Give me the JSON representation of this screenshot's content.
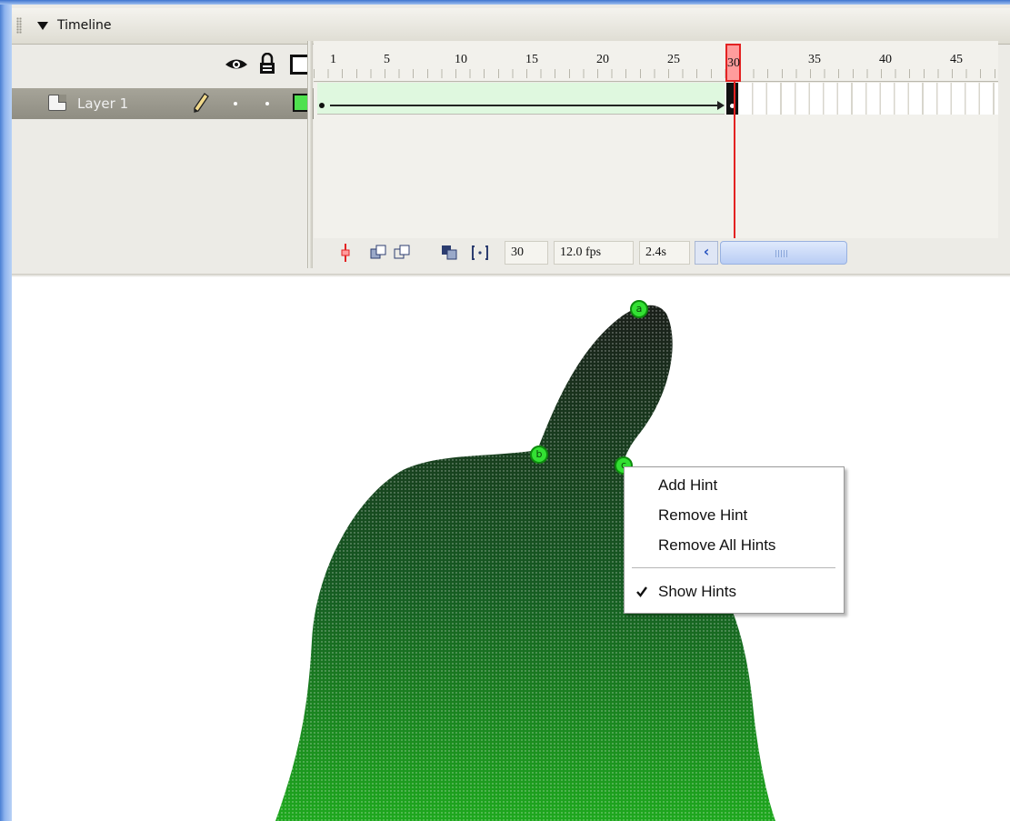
{
  "panel": {
    "title": "Timeline"
  },
  "layers": [
    {
      "name": "Layer 1",
      "color": "#4fe14f"
    }
  ],
  "ruler": {
    "tick_labels": [
      "1",
      "5",
      "10",
      "15",
      "20",
      "25",
      "30",
      "35",
      "40",
      "45"
    ],
    "current_frame_label": "30"
  },
  "status": {
    "current_frame": "30",
    "frame_rate": "12.0 fps",
    "elapsed_time": "2.4s"
  },
  "hints": [
    "a",
    "b",
    "c"
  ],
  "context_menu": {
    "items": [
      "Add Hint",
      "Remove Hint",
      "Remove All Hints"
    ],
    "checked_item": "Show Hints"
  },
  "colors": {
    "hint_marker": "#33e033",
    "playhead": "#e32222",
    "tween_fill": "#dff8df",
    "shape_top": "#1a1f1a",
    "shape_bottom": "#1ea81e"
  },
  "icons": {
    "eye": "eye-icon",
    "lock": "lock-icon",
    "outline": "outline-icon",
    "pencil": "pencil-icon",
    "trash": "trash-icon",
    "check": "check-icon"
  }
}
